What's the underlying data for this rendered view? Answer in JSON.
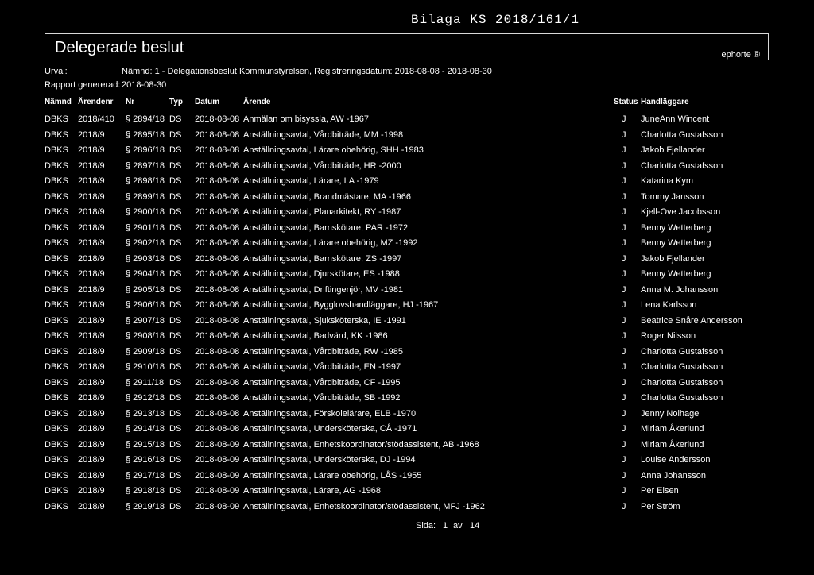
{
  "stamp": "Bilaga KS 2018/161/1",
  "title": "Delegerade beslut",
  "brand": "ephorte ®",
  "meta": {
    "urval_label": "Urval:",
    "urval_value": "Nämnd: 1 - Delegationsbeslut Kommunstyrelsen, Registreringsdatum: 2018-08-08 - 2018-08-30",
    "rapport_label": "Rapport genererad:",
    "rapport_value": "2018-08-30"
  },
  "columns": {
    "namnd": "Nämnd",
    "arendenr": "Ärendenr",
    "nr": "Nr",
    "typ": "Typ",
    "datum": "Datum",
    "arende": "Ärende",
    "status": "Status",
    "handlaggare": "Handläggare"
  },
  "rows": [
    {
      "namnd": "DBKS",
      "arendenr": "2018/410",
      "nr": "§ 2894/18",
      "typ": "DS",
      "datum": "2018-08-08",
      "arende": "Anmälan om bisyssla, AW -1967",
      "status": "J",
      "handlaggare": "JuneAnn Wincent"
    },
    {
      "namnd": "DBKS",
      "arendenr": "2018/9",
      "nr": "§ 2895/18",
      "typ": "DS",
      "datum": "2018-08-08",
      "arende": "Anställningsavtal, Vårdbiträde, MM -1998",
      "status": "J",
      "handlaggare": "Charlotta Gustafsson"
    },
    {
      "namnd": "DBKS",
      "arendenr": "2018/9",
      "nr": "§ 2896/18",
      "typ": "DS",
      "datum": "2018-08-08",
      "arende": "Anställningsavtal, Lärare obehörig, SHH -1983",
      "status": "J",
      "handlaggare": "Jakob Fjellander"
    },
    {
      "namnd": "DBKS",
      "arendenr": "2018/9",
      "nr": "§ 2897/18",
      "typ": "DS",
      "datum": "2018-08-08",
      "arende": "Anställningsavtal, Vårdbiträde, HR -2000",
      "status": "J",
      "handlaggare": "Charlotta Gustafsson"
    },
    {
      "namnd": "DBKS",
      "arendenr": "2018/9",
      "nr": "§ 2898/18",
      "typ": "DS",
      "datum": "2018-08-08",
      "arende": "Anställningsavtal, Lärare, LA -1979",
      "status": "J",
      "handlaggare": "Katarina Kym"
    },
    {
      "namnd": "DBKS",
      "arendenr": "2018/9",
      "nr": "§ 2899/18",
      "typ": "DS",
      "datum": "2018-08-08",
      "arende": "Anställningsavtal, Brandmästare, MA -1966",
      "status": "J",
      "handlaggare": "Tommy Jansson"
    },
    {
      "namnd": "DBKS",
      "arendenr": "2018/9",
      "nr": "§ 2900/18",
      "typ": "DS",
      "datum": "2018-08-08",
      "arende": "Anställningsavtal, Planarkitekt, RY -1987",
      "status": "J",
      "handlaggare": "Kjell-Ove Jacobsson"
    },
    {
      "namnd": "DBKS",
      "arendenr": "2018/9",
      "nr": "§ 2901/18",
      "typ": "DS",
      "datum": "2018-08-08",
      "arende": "Anställningsavtal, Barnskötare, PAR -1972",
      "status": "J",
      "handlaggare": "Benny Wetterberg"
    },
    {
      "namnd": "DBKS",
      "arendenr": "2018/9",
      "nr": "§ 2902/18",
      "typ": "DS",
      "datum": "2018-08-08",
      "arende": "Anställningsavtal, Lärare obehörig, MZ -1992",
      "status": "J",
      "handlaggare": "Benny Wetterberg"
    },
    {
      "namnd": "DBKS",
      "arendenr": "2018/9",
      "nr": "§ 2903/18",
      "typ": "DS",
      "datum": "2018-08-08",
      "arende": "Anställningsavtal, Barnskötare, ZS -1997",
      "status": "J",
      "handlaggare": "Jakob Fjellander"
    },
    {
      "namnd": "DBKS",
      "arendenr": "2018/9",
      "nr": "§ 2904/18",
      "typ": "DS",
      "datum": "2018-08-08",
      "arende": "Anställningsavtal, Djurskötare, ES -1988",
      "status": "J",
      "handlaggare": "Benny Wetterberg"
    },
    {
      "namnd": "DBKS",
      "arendenr": "2018/9",
      "nr": "§ 2905/18",
      "typ": "DS",
      "datum": "2018-08-08",
      "arende": "Anställningsavtal, Driftingenjör, MV -1981",
      "status": "J",
      "handlaggare": "Anna M. Johansson"
    },
    {
      "namnd": "DBKS",
      "arendenr": "2018/9",
      "nr": "§ 2906/18",
      "typ": "DS",
      "datum": "2018-08-08",
      "arende": "Anställningsavtal, Bygglovshandläggare, HJ -1967",
      "status": "J",
      "handlaggare": "Lena Karlsson"
    },
    {
      "namnd": "DBKS",
      "arendenr": "2018/9",
      "nr": "§ 2907/18",
      "typ": "DS",
      "datum": "2018-08-08",
      "arende": "Anställningsavtal, Sjuksköterska, IE -1991",
      "status": "J",
      "handlaggare": "Beatrice Snåre Andersson"
    },
    {
      "namnd": "DBKS",
      "arendenr": "2018/9",
      "nr": "§ 2908/18",
      "typ": "DS",
      "datum": "2018-08-08",
      "arende": "Anställningsavtal, Badvärd, KK -1986",
      "status": "J",
      "handlaggare": "Roger Nilsson"
    },
    {
      "namnd": "DBKS",
      "arendenr": "2018/9",
      "nr": "§ 2909/18",
      "typ": "DS",
      "datum": "2018-08-08",
      "arende": "Anställningsavtal, Vårdbiträde, RW -1985",
      "status": "J",
      "handlaggare": "Charlotta Gustafsson"
    },
    {
      "namnd": "DBKS",
      "arendenr": "2018/9",
      "nr": "§ 2910/18",
      "typ": "DS",
      "datum": "2018-08-08",
      "arende": "Anställningsavtal, Vårdbiträde, EN -1997",
      "status": "J",
      "handlaggare": "Charlotta Gustafsson"
    },
    {
      "namnd": "DBKS",
      "arendenr": "2018/9",
      "nr": "§ 2911/18",
      "typ": "DS",
      "datum": "2018-08-08",
      "arende": "Anställningsavtal, Vårdbiträde, CF -1995",
      "status": "J",
      "handlaggare": "Charlotta Gustafsson"
    },
    {
      "namnd": "DBKS",
      "arendenr": "2018/9",
      "nr": "§ 2912/18",
      "typ": "DS",
      "datum": "2018-08-08",
      "arende": "Anställningsavtal, Vårdbiträde, SB -1992",
      "status": "J",
      "handlaggare": "Charlotta Gustafsson"
    },
    {
      "namnd": "DBKS",
      "arendenr": "2018/9",
      "nr": "§ 2913/18",
      "typ": "DS",
      "datum": "2018-08-08",
      "arende": "Anställningsavtal, Förskolelärare, ELB -1970",
      "status": "J",
      "handlaggare": "Jenny Nolhage"
    },
    {
      "namnd": "DBKS",
      "arendenr": "2018/9",
      "nr": "§ 2914/18",
      "typ": "DS",
      "datum": "2018-08-08",
      "arende": "Anställningsavtal, Undersköterska, CÅ -1971",
      "status": "J",
      "handlaggare": "Miriam Åkerlund"
    },
    {
      "namnd": "DBKS",
      "arendenr": "2018/9",
      "nr": "§ 2915/18",
      "typ": "DS",
      "datum": "2018-08-09",
      "arende": "Anställningsavtal, Enhetskoordinator/stödassistent, AB -1968",
      "status": "J",
      "handlaggare": "Miriam Åkerlund"
    },
    {
      "namnd": "DBKS",
      "arendenr": "2018/9",
      "nr": "§ 2916/18",
      "typ": "DS",
      "datum": "2018-08-09",
      "arende": "Anställningsavtal, Undersköterska, DJ -1994",
      "status": "J",
      "handlaggare": "Louise Andersson"
    },
    {
      "namnd": "DBKS",
      "arendenr": "2018/9",
      "nr": "§ 2917/18",
      "typ": "DS",
      "datum": "2018-08-09",
      "arende": "Anställningsavtal, Lärare obehörig, LÅS -1955",
      "status": "J",
      "handlaggare": "Anna Johansson"
    },
    {
      "namnd": "DBKS",
      "arendenr": "2018/9",
      "nr": "§ 2918/18",
      "typ": "DS",
      "datum": "2018-08-09",
      "arende": "Anställningsavtal, Lärare, AG -1968",
      "status": "J",
      "handlaggare": "Per Eisen"
    },
    {
      "namnd": "DBKS",
      "arendenr": "2018/9",
      "nr": "§ 2919/18",
      "typ": "DS",
      "datum": "2018-08-09",
      "arende": "Anställningsavtal, Enhetskoordinator/stödassistent, MFJ -1962",
      "status": "J",
      "handlaggare": "Per Ström"
    }
  ],
  "pagination": {
    "label": "Sida:",
    "current": "1",
    "of": "av",
    "total": "14"
  }
}
